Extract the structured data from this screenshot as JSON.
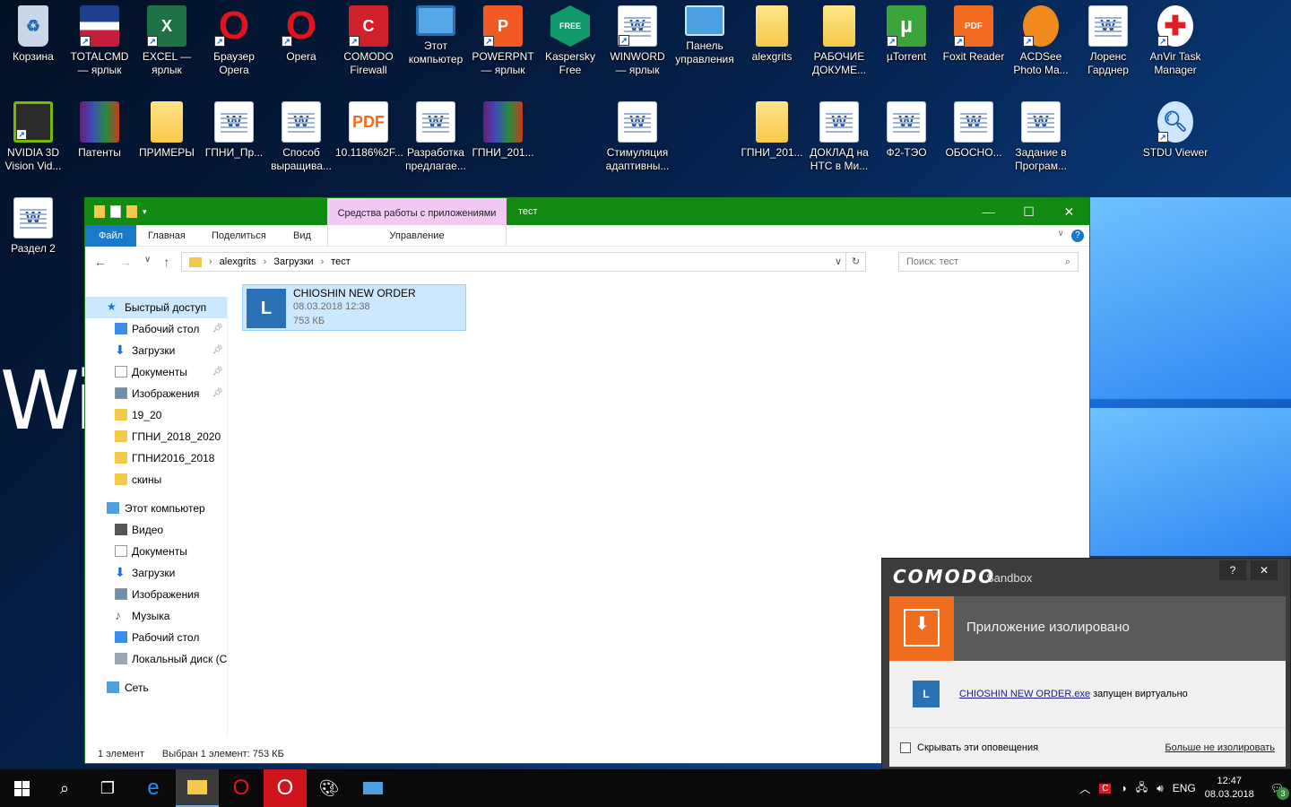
{
  "desktop": {
    "bg_text": "Wi",
    "icons": [
      {
        "label": "Корзина"
      },
      {
        "label": "TOTALCMD\n— ярлык"
      },
      {
        "label": "EXCEL —\nярлык"
      },
      {
        "label": "Браузер\nOpera"
      },
      {
        "label": "Opera"
      },
      {
        "label": "COMODO\nFirewall"
      },
      {
        "label": "Этот\nкомпьютер"
      },
      {
        "label": "POWERPNT\n— ярлык"
      },
      {
        "label": "Kaspersky\nFree"
      },
      {
        "label": "WINWORD\n— ярлык"
      },
      {
        "label": "Панель\nуправления"
      },
      {
        "label": "alexgrits"
      },
      {
        "label": "РАБОЧИЕ\nДОКУМЕ..."
      },
      {
        "label": "µTorrent"
      },
      {
        "label": "Foxit Reader"
      },
      {
        "label": "ACDSee\nPhoto Ma..."
      },
      {
        "label": "Лоренс\nГарднер"
      },
      {
        "label": "AnVir Task\nManager"
      },
      {
        "label": "NVIDIA 3D\nVision Vid..."
      },
      {
        "label": "Патенты"
      },
      {
        "label": "ПРИМЕРЫ"
      },
      {
        "label": "ГПНИ_Пр..."
      },
      {
        "label": "Способ\nвыращива..."
      },
      {
        "label": "10.1186%2F..."
      },
      {
        "label": "Разработка\nпредлагае..."
      },
      {
        "label": "ГПНИ_201..."
      },
      {
        "label": "Стимуляция\nадаптивны..."
      },
      {
        "label": "ГПНИ_201..."
      },
      {
        "label": "ДОКЛАД на\nНТС в Ми..."
      },
      {
        "label": "Ф2-ТЭО"
      },
      {
        "label": "ОБОСНО..."
      },
      {
        "label": "Задание в\nПрограм..."
      },
      {
        "label": "STDU Viewer"
      },
      {
        "label": "Раздел 2"
      }
    ]
  },
  "explorer": {
    "title": "тест",
    "context_tab": "Средства работы с приложениями",
    "ribbon_tabs": [
      "Файл",
      "Главная",
      "Поделиться",
      "Вид"
    ],
    "context_sub": "Управление",
    "address": [
      "alexgrits",
      "Загрузки",
      "тест"
    ],
    "search_placeholder": "Поиск: тест",
    "nav": [
      {
        "label": "Быстрый доступ"
      },
      {
        "label": "Рабочий стол"
      },
      {
        "label": "Загрузки"
      },
      {
        "label": "Документы"
      },
      {
        "label": "Изображения"
      },
      {
        "label": "19_20"
      },
      {
        "label": "ГПНИ_2018_2020"
      },
      {
        "label": "ГПНИ2016_2018"
      },
      {
        "label": "скины"
      },
      {
        "label": "Этот компьютер"
      },
      {
        "label": "Видео"
      },
      {
        "label": "Документы"
      },
      {
        "label": "Загрузки"
      },
      {
        "label": "Изображения"
      },
      {
        "label": "Музыка"
      },
      {
        "label": "Рабочий стол"
      },
      {
        "label": "Локальный диск (C"
      },
      {
        "label": "Сеть"
      }
    ],
    "file": {
      "name": "CHIOSHIN NEW ORDER",
      "date": "08.03.2018 12:38",
      "size": "753 КБ"
    },
    "status": {
      "count": "1 элемент",
      "selected": "Выбран 1 элемент: 753 КБ"
    }
  },
  "comodo": {
    "brand": "COMODO",
    "product": "Sandbox",
    "help": "?",
    "close": "✕",
    "headline": "Приложение изолировано",
    "app_link": "CHIOSHIN NEW ORDER.exe",
    "app_msg": "запущен виртуально",
    "hide_label": "Скрывать эти оповещения",
    "no_isolate": "Больше не изолировать"
  },
  "taskbar": {
    "lang": "ENG",
    "time": "12:47",
    "date": "08.03.2018",
    "notif_count": "3"
  }
}
